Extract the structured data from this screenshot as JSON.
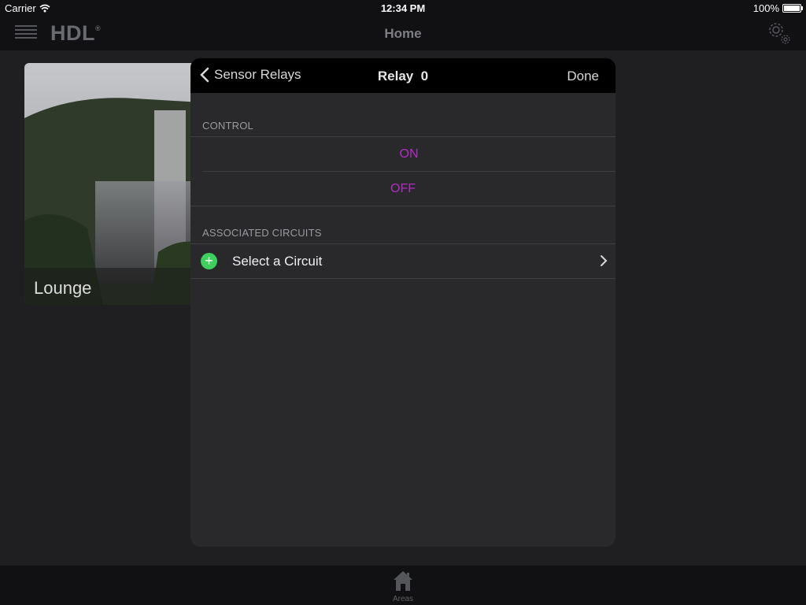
{
  "status_bar": {
    "carrier": "Carrier",
    "time": "12:34 PM",
    "battery": "100%"
  },
  "nav": {
    "logo": "HDL",
    "logo_mark": "®",
    "title": "Home"
  },
  "area_card": {
    "label": "Lounge"
  },
  "modal": {
    "back_label": "Sensor Relays",
    "title": "Relay  0",
    "done_label": "Done",
    "control_header": "CONTROL",
    "on_label": "ON",
    "off_label": "OFF",
    "circuits_header": "ASSOCIATED CIRCUITS",
    "select_circuit_label": "Select a Circuit"
  },
  "tab_bar": {
    "areas_label": "Areas"
  },
  "colors": {
    "accent": "#b32cc2",
    "add_green": "#3fcf5c",
    "background": "#1f1f22",
    "header": "#000000"
  }
}
